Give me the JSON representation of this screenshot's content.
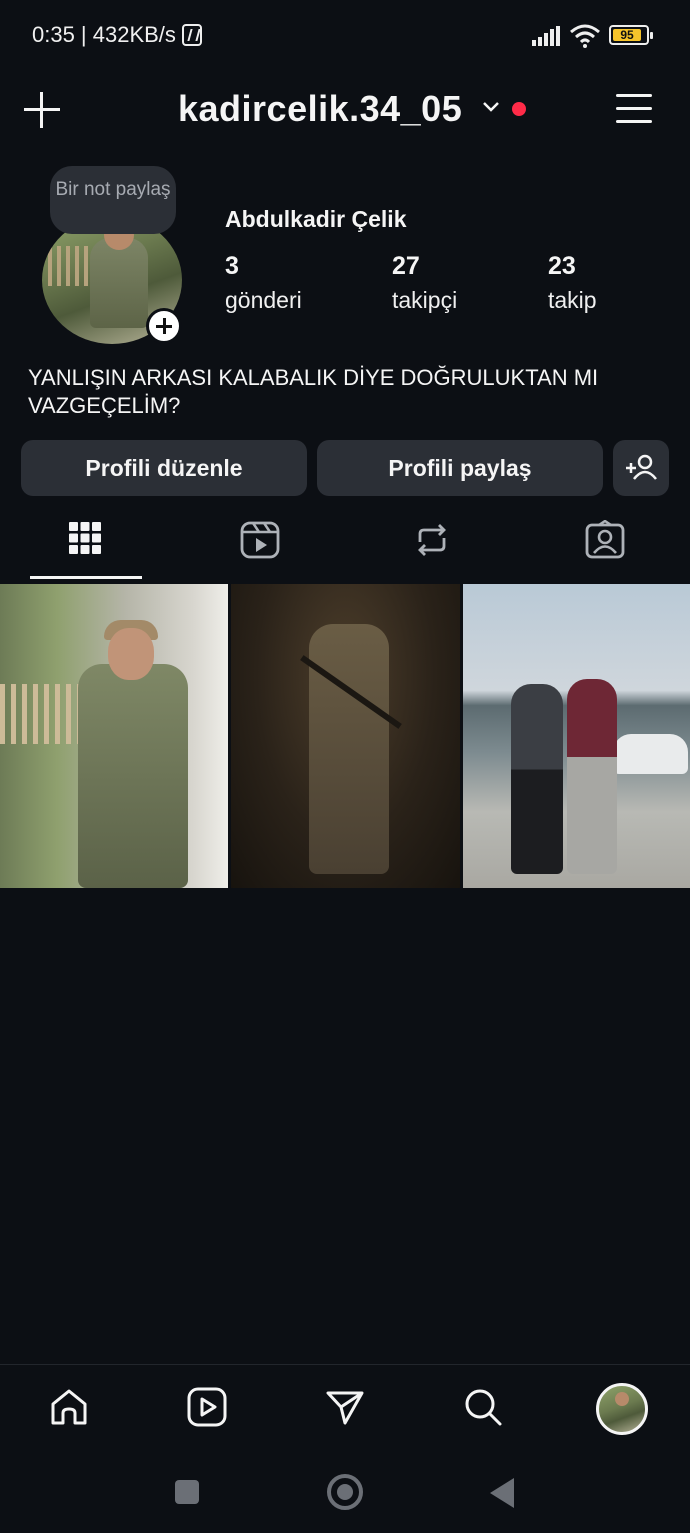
{
  "status_bar": {
    "time_speed": "0:35 | 432KB/s",
    "battery_level": "95"
  },
  "header": {
    "username": "kadircelik.34_05",
    "notification_dot_color": "#ff2b48"
  },
  "profile": {
    "note_text": "Bir not paylaş",
    "full_name": "Abdulkadir Çelik",
    "stats": [
      {
        "value": "3",
        "label": "gönderi"
      },
      {
        "value": "27",
        "label": "takipçi"
      },
      {
        "value": "23",
        "label": "takip"
      }
    ],
    "bio": "YANLIŞIN ARKASI KALABALIK DİYE DOĞRULUKTAN MI VAZGEÇELİM?"
  },
  "buttons": {
    "edit_profile": "Profili düzenle",
    "share_profile": "Profili paylaş"
  },
  "tabs": [
    {
      "name": "grid-icon",
      "active": true
    },
    {
      "name": "reels-icon",
      "active": false
    },
    {
      "name": "reposts-icon",
      "active": false
    },
    {
      "name": "tagged-icon",
      "active": false
    }
  ],
  "posts": [
    {
      "name": "post-soldier-sitting"
    },
    {
      "name": "post-soldier-night"
    },
    {
      "name": "post-two-men"
    }
  ],
  "bottom_nav": [
    "home-icon",
    "reels-icon",
    "direct-icon",
    "search-icon",
    "profile-avatar"
  ],
  "colors": {
    "background": "#0c0f14",
    "button_bg": "#2b2f36",
    "battery": "#f6c42b"
  }
}
